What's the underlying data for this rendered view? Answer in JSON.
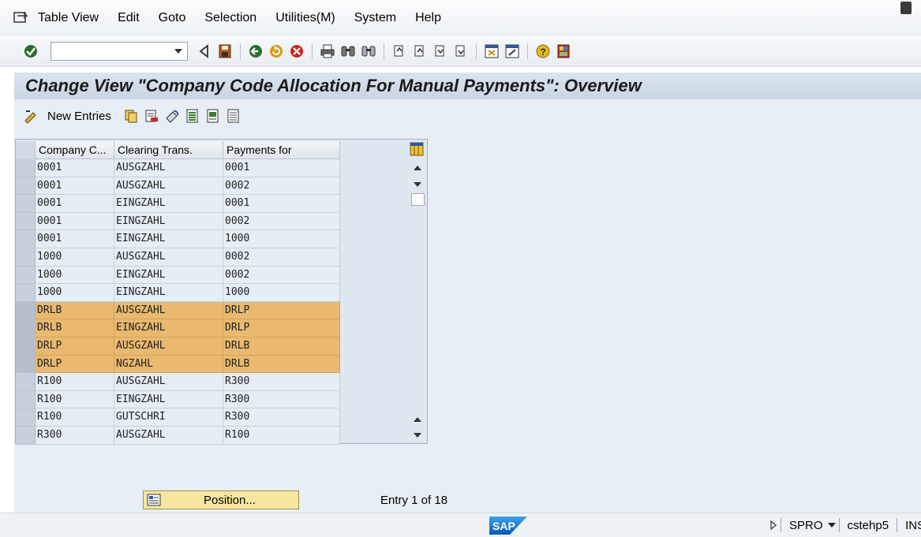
{
  "menu": {
    "items": [
      {
        "label": "Table View"
      },
      {
        "label": "Edit"
      },
      {
        "label": "Goto"
      },
      {
        "label": "Selection"
      },
      {
        "label": "Utilities(M)"
      },
      {
        "label": "System"
      },
      {
        "label": "Help"
      }
    ]
  },
  "toolbar": {
    "command_field_value": ""
  },
  "title": "Change View \"Company Code Allocation For Manual Payments\": Overview",
  "app_toolbar": {
    "new_entries_label": "New Entries"
  },
  "table": {
    "columns": [
      "Company C...",
      "Clearing Trans.",
      "Payments for"
    ],
    "rows": [
      {
        "company_code": "0001",
        "clearing": "AUSGZAHL",
        "payments_for": "0001",
        "highlighted": false
      },
      {
        "company_code": "0001",
        "clearing": "AUSGZAHL",
        "payments_for": "0002",
        "highlighted": false
      },
      {
        "company_code": "0001",
        "clearing": "EINGZAHL",
        "payments_for": "0001",
        "highlighted": false
      },
      {
        "company_code": "0001",
        "clearing": "EINGZAHL",
        "payments_for": "0002",
        "highlighted": false
      },
      {
        "company_code": "0001",
        "clearing": "EINGZAHL",
        "payments_for": "1000",
        "highlighted": false
      },
      {
        "company_code": "1000",
        "clearing": "AUSGZAHL",
        "payments_for": "0002",
        "highlighted": false
      },
      {
        "company_code": "1000",
        "clearing": "EINGZAHL",
        "payments_for": "0002",
        "highlighted": false
      },
      {
        "company_code": "1000",
        "clearing": "EINGZAHL",
        "payments_for": "1000",
        "highlighted": false
      },
      {
        "company_code": "DRLB",
        "clearing": "AUSGZAHL",
        "payments_for": "DRLP",
        "highlighted": true
      },
      {
        "company_code": "DRLB",
        "clearing": "EINGZAHL",
        "payments_for": "DRLP",
        "highlighted": true
      },
      {
        "company_code": "DRLP",
        "clearing": "AUSGZAHL",
        "payments_for": "DRLB",
        "highlighted": true
      },
      {
        "company_code": "DRLP",
        "clearing": "NGZAHL",
        "payments_for": "DRLB",
        "highlighted": true
      },
      {
        "company_code": "R100",
        "clearing": "AUSGZAHL",
        "payments_for": "R300",
        "highlighted": false
      },
      {
        "company_code": "R100",
        "clearing": "EINGZAHL",
        "payments_for": "R300",
        "highlighted": false
      },
      {
        "company_code": "R100",
        "clearing": "GUTSCHRI",
        "payments_for": "R300",
        "highlighted": false
      },
      {
        "company_code": "R300",
        "clearing": "AUSGZAHL",
        "payments_for": "R100",
        "highlighted": false
      }
    ]
  },
  "position_button_label": "Position...",
  "entry_text": "Entry 1 of 18",
  "status": {
    "transaction": "SPRO",
    "server": "cstehp5",
    "mode": "INS"
  },
  "colors": {
    "highlight_row": "#e8b96f",
    "title_bg": "#d2dde9"
  }
}
